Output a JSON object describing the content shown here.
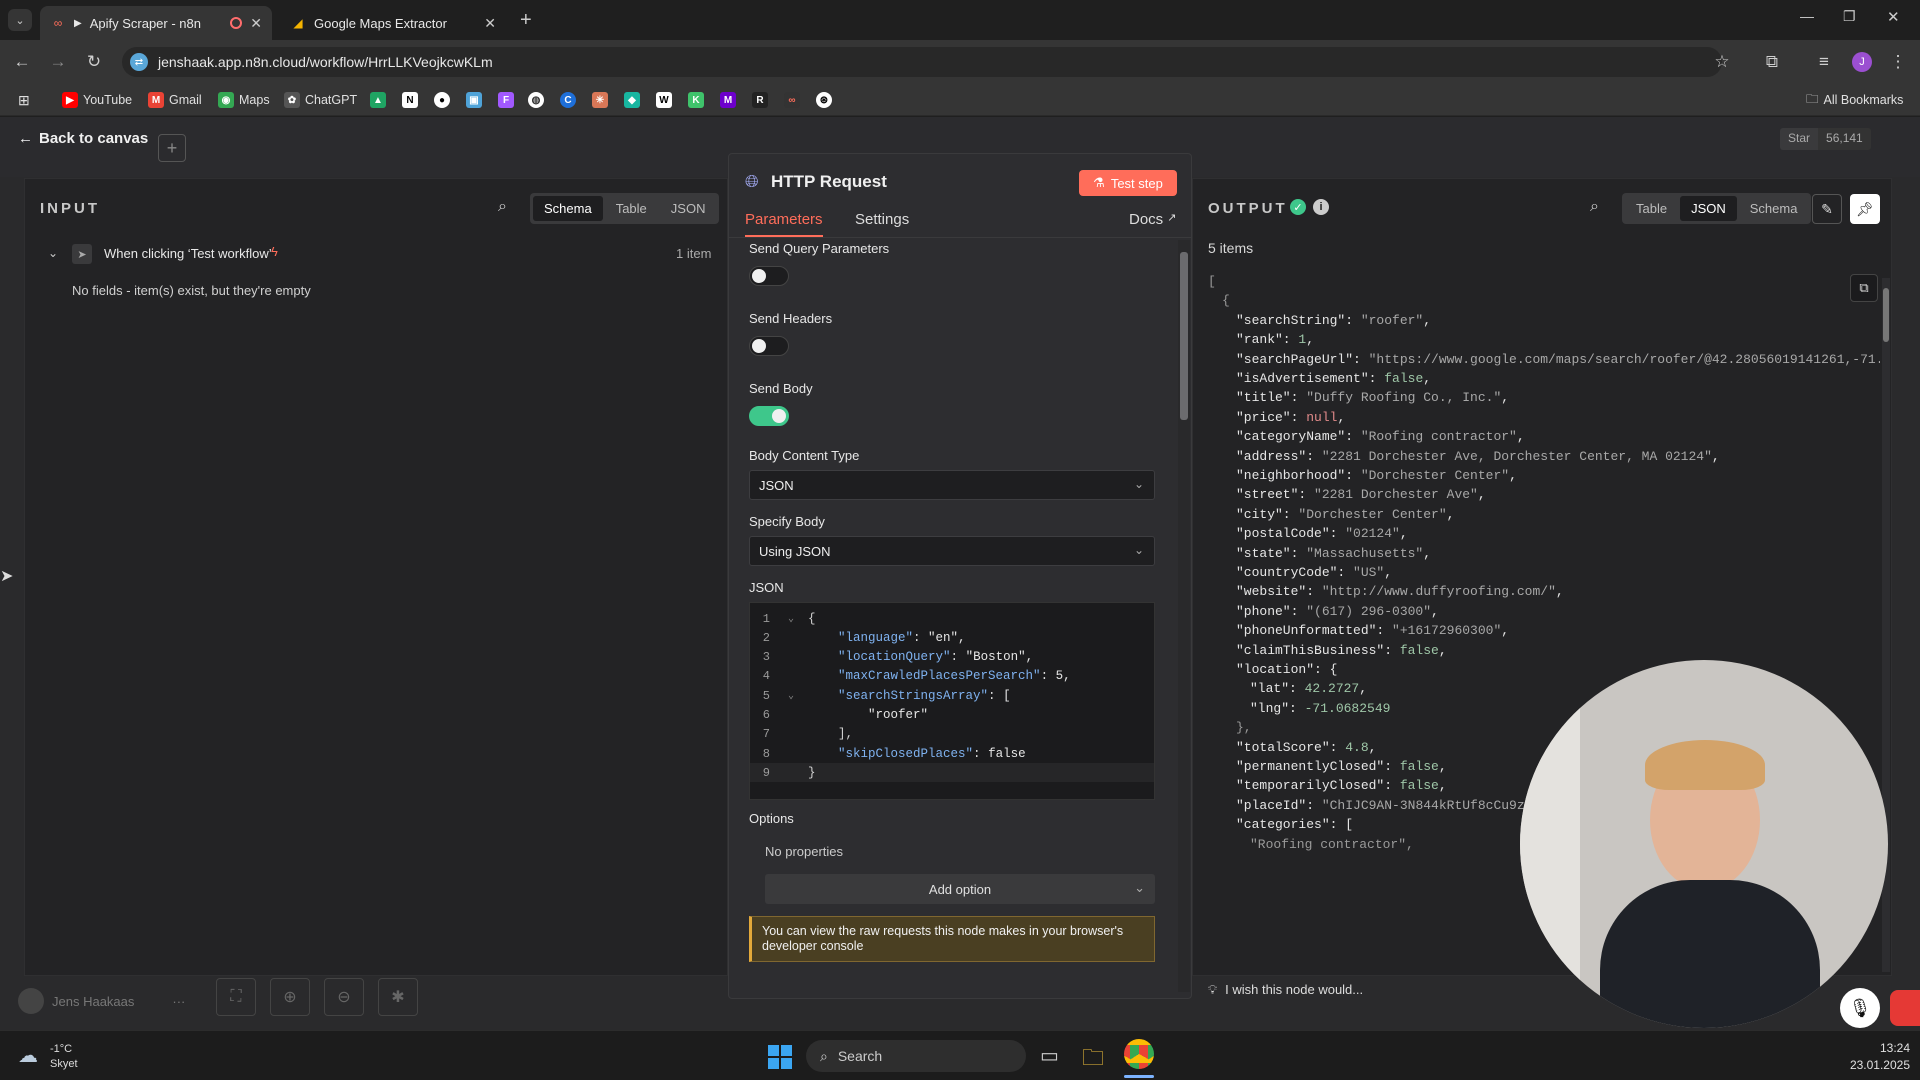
{
  "browser": {
    "tabs": [
      {
        "title": "Apify Scraper - n8n",
        "active": true,
        "recording": true
      },
      {
        "title": "Google Maps Extractor",
        "active": false
      }
    ],
    "url": "jenshaak.app.n8n.cloud/workflow/HrrLLKVeojkcwKLm",
    "bookmarks": [
      "YouTube",
      "Gmail",
      "Maps",
      "ChatGPT"
    ],
    "all_bookmarks": "All Bookmarks",
    "profile_initial": "J"
  },
  "n8n": {
    "back_label": "Back to canvas",
    "github_star": "Star",
    "github_count": "56,141",
    "user_name": "Jens Haakaas",
    "input": {
      "title": "INPUT",
      "tabs": [
        "Schema",
        "Table",
        "JSON"
      ],
      "active_tab": "Schema",
      "trigger": "When clicking ‘Test workflow’",
      "items_count": "1 item",
      "empty_message": "No fields - item(s) exist, but they're empty"
    },
    "node": {
      "title": "HTTP Request",
      "test_button": "Test step",
      "tabs": [
        "Parameters",
        "Settings"
      ],
      "docs": "Docs",
      "send_query_label": "Send Query Parameters",
      "send_headers_label": "Send Headers",
      "send_body_label": "Send Body",
      "body_content_type_label": "Body Content Type",
      "body_content_type_value": "JSON",
      "specify_body_label": "Specify Body",
      "specify_body_value": "Using JSON",
      "json_label": "JSON",
      "code_lines": [
        "{",
        "    \"language\": \"en\",",
        "    \"locationQuery\": \"Boston\",",
        "    \"maxCrawledPlacesPerSearch\": 5,",
        "    \"searchStringsArray\": [",
        "        \"roofer\"",
        "    ],",
        "    \"skipClosedPlaces\": false",
        "}"
      ],
      "options_label": "Options",
      "no_properties": "No properties",
      "add_option": "Add option",
      "info_notice": "You can view the raw requests this node makes in your browser's developer console"
    },
    "output": {
      "title": "OUTPUT",
      "tabs": [
        "Table",
        "JSON",
        "Schema"
      ],
      "active_tab": "JSON",
      "items_count": "5 items",
      "wish_text": "I wish this node would...",
      "json_lines": [
        {
          "indent": 0,
          "text": "["
        },
        {
          "indent": 1,
          "text": "{"
        },
        {
          "indent": 2,
          "key": "searchString",
          "value": "\"roofer\"",
          "vtype": "s"
        },
        {
          "indent": 2,
          "key": "rank",
          "value": "1",
          "vtype": "n"
        },
        {
          "indent": 2,
          "key": "searchPageUrl",
          "value": "\"https://www.google.com/maps/search/roofer/@42.28056019141261,-71.",
          "vtype": "s"
        },
        {
          "indent": 2,
          "key": "isAdvertisement",
          "value": "false",
          "vtype": "b"
        },
        {
          "indent": 2,
          "key": "title",
          "value": "\"Duffy Roofing Co., Inc.\"",
          "vtype": "s"
        },
        {
          "indent": 2,
          "key": "price",
          "value": "null",
          "vtype": "null"
        },
        {
          "indent": 2,
          "key": "categoryName",
          "value": "\"Roofing contractor\"",
          "vtype": "s"
        },
        {
          "indent": 2,
          "key": "address",
          "value": "\"2281 Dorchester Ave, Dorchester Center, MA 02124\"",
          "vtype": "s"
        },
        {
          "indent": 2,
          "key": "neighborhood",
          "value": "\"Dorchester Center\"",
          "vtype": "s"
        },
        {
          "indent": 2,
          "key": "street",
          "value": "\"2281 Dorchester Ave\"",
          "vtype": "s"
        },
        {
          "indent": 2,
          "key": "city",
          "value": "\"Dorchester Center\"",
          "vtype": "s"
        },
        {
          "indent": 2,
          "key": "postalCode",
          "value": "\"02124\"",
          "vtype": "s"
        },
        {
          "indent": 2,
          "key": "state",
          "value": "\"Massachusetts\"",
          "vtype": "s"
        },
        {
          "indent": 2,
          "key": "countryCode",
          "value": "\"US\"",
          "vtype": "s"
        },
        {
          "indent": 2,
          "key": "website",
          "value": "\"http://www.duffyroofing.com/\"",
          "vtype": "s"
        },
        {
          "indent": 2,
          "key": "phone",
          "value": "\"(617) 296-0300\"",
          "vtype": "s"
        },
        {
          "indent": 2,
          "key": "phoneUnformatted",
          "value": "\"+16172960300\"",
          "vtype": "s"
        },
        {
          "indent": 2,
          "key": "claimThisBusiness",
          "value": "false",
          "vtype": "b"
        },
        {
          "indent": 2,
          "key": "location",
          "value": "{",
          "vtype": "p",
          "nocomma": true
        },
        {
          "indent": 3,
          "key": "lat",
          "value": "42.2727",
          "vtype": "n"
        },
        {
          "indent": 3,
          "key": "lng",
          "value": "-71.0682549",
          "vtype": "n",
          "nocomma": true
        },
        {
          "indent": 2,
          "text": "},"
        },
        {
          "indent": 2,
          "key": "totalScore",
          "value": "4.8",
          "vtype": "n"
        },
        {
          "indent": 2,
          "key": "permanentlyClosed",
          "value": "false",
          "vtype": "b"
        },
        {
          "indent": 2,
          "key": "temporarilyClosed",
          "value": "false",
          "vtype": "b"
        },
        {
          "indent": 2,
          "key": "placeId",
          "value": "\"ChIJC9AN-3N844kRtUf8cCu9zp",
          "vtype": "s",
          "nocomma": true
        },
        {
          "indent": 2,
          "key": "categories",
          "value": "[",
          "vtype": "p",
          "nocomma": true
        },
        {
          "indent": 3,
          "text": "\"Roofing contractor\","
        }
      ]
    }
  },
  "taskbar": {
    "temperature": "-1°C",
    "weather": "Skyet",
    "search_placeholder": "Search",
    "time": "13:24",
    "date": "23.01.2025"
  },
  "colors": {
    "accent": "#ff6d5a",
    "success": "#3ec78b",
    "link": "#7fb2f0"
  }
}
